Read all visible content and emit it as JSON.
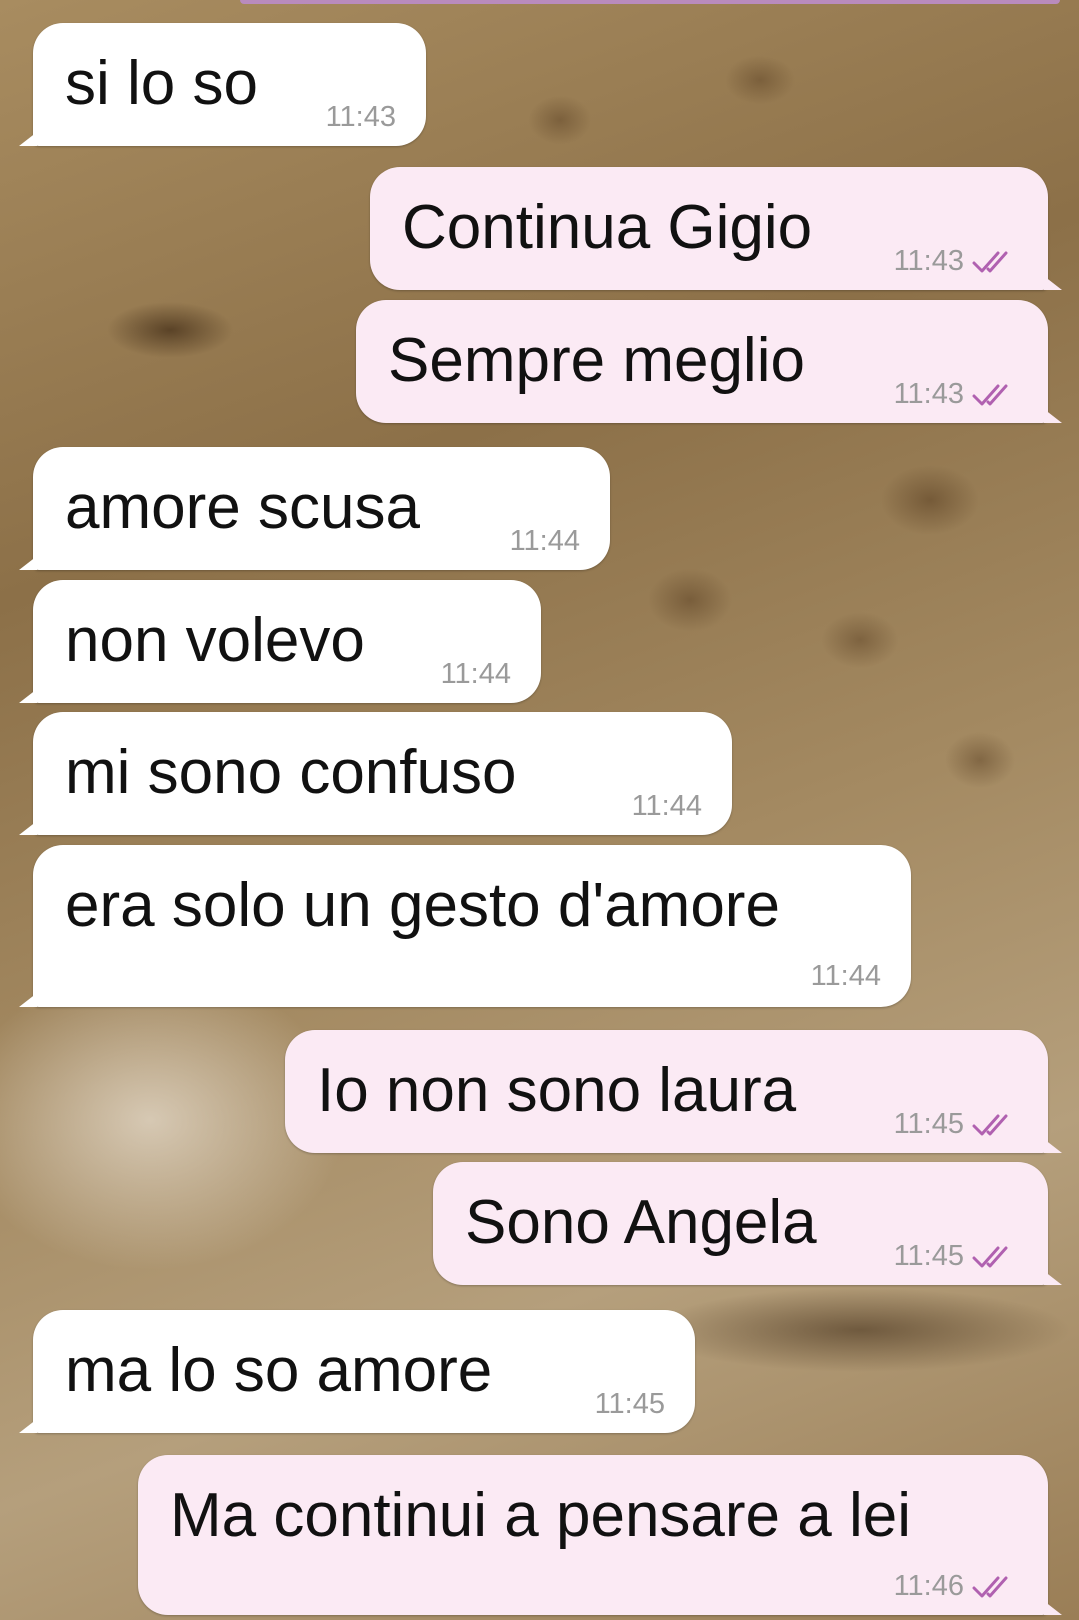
{
  "chat": {
    "colors": {
      "incoming_bubble": "#ffffff",
      "outgoing_bubble": "#fbeaf4",
      "read_ticks": "#b061b0",
      "time_text": "#9a9a9a"
    },
    "messages": [
      {
        "text": "si lo so",
        "time": "11:43",
        "direction": "incoming"
      },
      {
        "text": "Continua Gigio",
        "time": "11:43",
        "direction": "outgoing",
        "status": "read-double-tick-icon"
      },
      {
        "text": "Sempre meglio",
        "time": "11:43",
        "direction": "outgoing",
        "status": "read-double-tick-icon"
      },
      {
        "text": "amore scusa",
        "time": "11:44",
        "direction": "incoming"
      },
      {
        "text": "non volevo",
        "time": "11:44",
        "direction": "incoming"
      },
      {
        "text": "mi sono confuso",
        "time": "11:44",
        "direction": "incoming"
      },
      {
        "text": "era solo un gesto d'amore",
        "time": "11:44",
        "direction": "incoming"
      },
      {
        "text": "Io non sono laura",
        "time": "11:45",
        "direction": "outgoing",
        "status": "read-double-tick-icon"
      },
      {
        "text": "Sono Angela",
        "time": "11:45",
        "direction": "outgoing",
        "status": "read-double-tick-icon"
      },
      {
        "text": "ma lo so amore",
        "time": "11:45",
        "direction": "incoming"
      },
      {
        "text": "Ma continui a pensare a lei",
        "time": "11:46",
        "direction": "outgoing",
        "status": "read-double-tick-icon"
      }
    ]
  }
}
